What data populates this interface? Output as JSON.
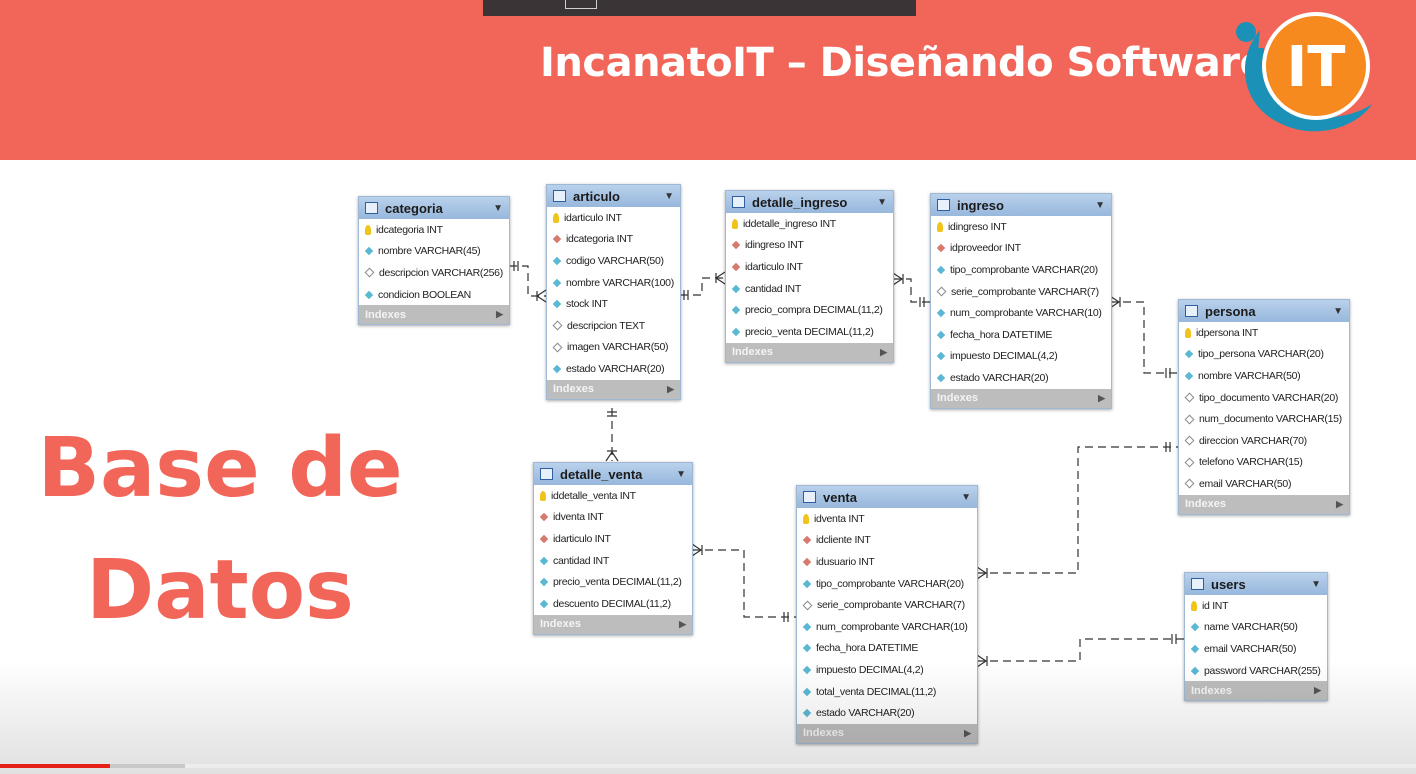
{
  "banner": {
    "title": "IncanatoIT – Diseñando Software",
    "logo_text": "IT"
  },
  "slide_title": {
    "line1": "Base de",
    "line2": "Datos"
  },
  "indexes_label": "Indexes",
  "video": {
    "progress_played": 0.078,
    "progress_loaded": 0.131
  },
  "colors": {
    "banner": "#f2665a",
    "table_header": "#a9c5e6",
    "primary_key": "#f0c419",
    "foreign_key": "#d77a6e",
    "column": "#5bb8d3"
  },
  "tables": [
    {
      "id": "categoria",
      "name": "categoria",
      "columns": [
        {
          "text": "idcategoria INT",
          "kind": "pk"
        },
        {
          "text": "nombre VARCHAR(45)",
          "kind": "nn"
        },
        {
          "text": "descripcion VARCHAR(256)",
          "kind": "nl"
        },
        {
          "text": "condicion BOOLEAN",
          "kind": "nn"
        }
      ]
    },
    {
      "id": "articulo",
      "name": "articulo",
      "columns": [
        {
          "text": "idarticulo INT",
          "kind": "pk"
        },
        {
          "text": "idcategoria INT",
          "kind": "fk"
        },
        {
          "text": "codigo VARCHAR(50)",
          "kind": "nn"
        },
        {
          "text": "nombre VARCHAR(100)",
          "kind": "nn"
        },
        {
          "text": "stock INT",
          "kind": "nn"
        },
        {
          "text": "descripcion TEXT",
          "kind": "nl"
        },
        {
          "text": "imagen VARCHAR(50)",
          "kind": "nl"
        },
        {
          "text": "estado VARCHAR(20)",
          "kind": "nn"
        }
      ]
    },
    {
      "id": "detalle_ingreso",
      "name": "detalle_ingreso",
      "columns": [
        {
          "text": "iddetalle_ingreso INT",
          "kind": "pk"
        },
        {
          "text": "idingreso INT",
          "kind": "fk"
        },
        {
          "text": "idarticulo INT",
          "kind": "fk"
        },
        {
          "text": "cantidad INT",
          "kind": "nn"
        },
        {
          "text": "precio_compra DECIMAL(11,2)",
          "kind": "nn"
        },
        {
          "text": "precio_venta DECIMAL(11,2)",
          "kind": "nn"
        }
      ]
    },
    {
      "id": "ingreso",
      "name": "ingreso",
      "columns": [
        {
          "text": "idingreso INT",
          "kind": "pk"
        },
        {
          "text": "idproveedor INT",
          "kind": "fk"
        },
        {
          "text": "tipo_comprobante VARCHAR(20)",
          "kind": "nn"
        },
        {
          "text": "serie_comprobante VARCHAR(7)",
          "kind": "nl"
        },
        {
          "text": "num_comprobante VARCHAR(10)",
          "kind": "nn"
        },
        {
          "text": "fecha_hora DATETIME",
          "kind": "nn"
        },
        {
          "text": "impuesto DECIMAL(4,2)",
          "kind": "nn"
        },
        {
          "text": "estado VARCHAR(20)",
          "kind": "nn"
        }
      ]
    },
    {
      "id": "persona",
      "name": "persona",
      "columns": [
        {
          "text": "idpersona INT",
          "kind": "pk"
        },
        {
          "text": "tipo_persona VARCHAR(20)",
          "kind": "nn"
        },
        {
          "text": "nombre VARCHAR(50)",
          "kind": "nn"
        },
        {
          "text": "tipo_documento VARCHAR(20)",
          "kind": "nl"
        },
        {
          "text": "num_documento VARCHAR(15)",
          "kind": "nl"
        },
        {
          "text": "direccion VARCHAR(70)",
          "kind": "nl"
        },
        {
          "text": "telefono VARCHAR(15)",
          "kind": "nl"
        },
        {
          "text": "email VARCHAR(50)",
          "kind": "nl"
        }
      ]
    },
    {
      "id": "detalle_venta",
      "name": "detalle_venta",
      "columns": [
        {
          "text": "iddetalle_venta INT",
          "kind": "pk"
        },
        {
          "text": "idventa INT",
          "kind": "fk"
        },
        {
          "text": "idarticulo INT",
          "kind": "fk"
        },
        {
          "text": "cantidad INT",
          "kind": "nn"
        },
        {
          "text": "precio_venta DECIMAL(11,2)",
          "kind": "nn"
        },
        {
          "text": "descuento DECIMAL(11,2)",
          "kind": "nn"
        }
      ]
    },
    {
      "id": "venta",
      "name": "venta",
      "columns": [
        {
          "text": "idventa INT",
          "kind": "pk"
        },
        {
          "text": "idcliente INT",
          "kind": "fk"
        },
        {
          "text": "idusuario INT",
          "kind": "fk"
        },
        {
          "text": "tipo_comprobante VARCHAR(20)",
          "kind": "nn"
        },
        {
          "text": "serie_comprobante VARCHAR(7)",
          "kind": "nl"
        },
        {
          "text": "num_comprobante VARCHAR(10)",
          "kind": "nn"
        },
        {
          "text": "fecha_hora DATETIME",
          "kind": "nn"
        },
        {
          "text": "impuesto DECIMAL(4,2)",
          "kind": "nn"
        },
        {
          "text": "total_venta DECIMAL(11,2)",
          "kind": "nn"
        },
        {
          "text": "estado VARCHAR(20)",
          "kind": "nn"
        }
      ]
    },
    {
      "id": "users",
      "name": "users",
      "columns": [
        {
          "text": "id INT",
          "kind": "pk"
        },
        {
          "text": "name VARCHAR(50)",
          "kind": "nn"
        },
        {
          "text": "email VARCHAR(50)",
          "kind": "nn"
        },
        {
          "text": "password VARCHAR(255)",
          "kind": "nn"
        }
      ]
    }
  ],
  "relationships": [
    {
      "from": "categoria",
      "to": "articulo"
    },
    {
      "from": "articulo",
      "to": "detalle_ingreso"
    },
    {
      "from": "detalle_ingreso",
      "to": "ingreso"
    },
    {
      "from": "ingreso",
      "to": "persona"
    },
    {
      "from": "articulo",
      "to": "detalle_venta"
    },
    {
      "from": "detalle_venta",
      "to": "venta"
    },
    {
      "from": "venta",
      "to": "persona"
    },
    {
      "from": "venta",
      "to": "users"
    }
  ]
}
